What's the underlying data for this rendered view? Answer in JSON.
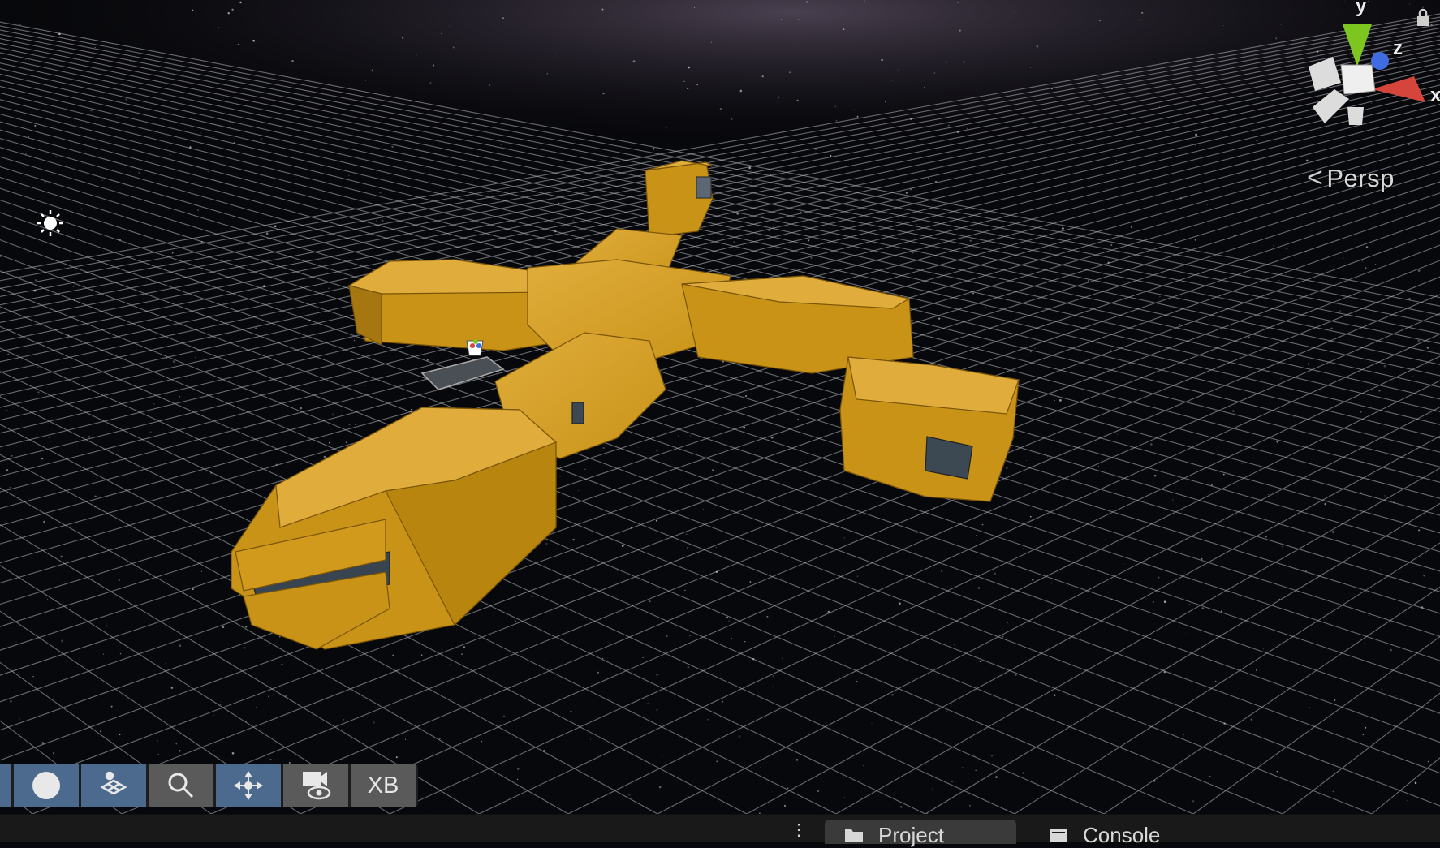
{
  "scene": {
    "projection_label": "Persp",
    "gizmo_axes": {
      "y": "y",
      "z": "z",
      "x": "x"
    },
    "colors": {
      "hull": "#d19a1d",
      "hull_top": "#dda93a",
      "hull_dark": "#a67610",
      "grid_line": "#b9bdc4",
      "gizmo_y": "#7cc61f",
      "gizmo_z": "#3f6ce0",
      "gizmo_x": "#d6453b"
    }
  },
  "overlay_toolbar": {
    "items": [
      {
        "icon": "sphere-icon"
      },
      {
        "icon": "layers-icon"
      },
      {
        "icon": "search-icon"
      },
      {
        "icon": "move-gizmo-icon"
      },
      {
        "icon": "camera-visibility-icon"
      },
      {
        "label": "XB"
      }
    ]
  },
  "dock": {
    "tabs": [
      {
        "label": "Project",
        "icon": "folder-icon",
        "active": true
      },
      {
        "label": "Console",
        "icon": "console-icon",
        "active": false
      }
    ]
  }
}
